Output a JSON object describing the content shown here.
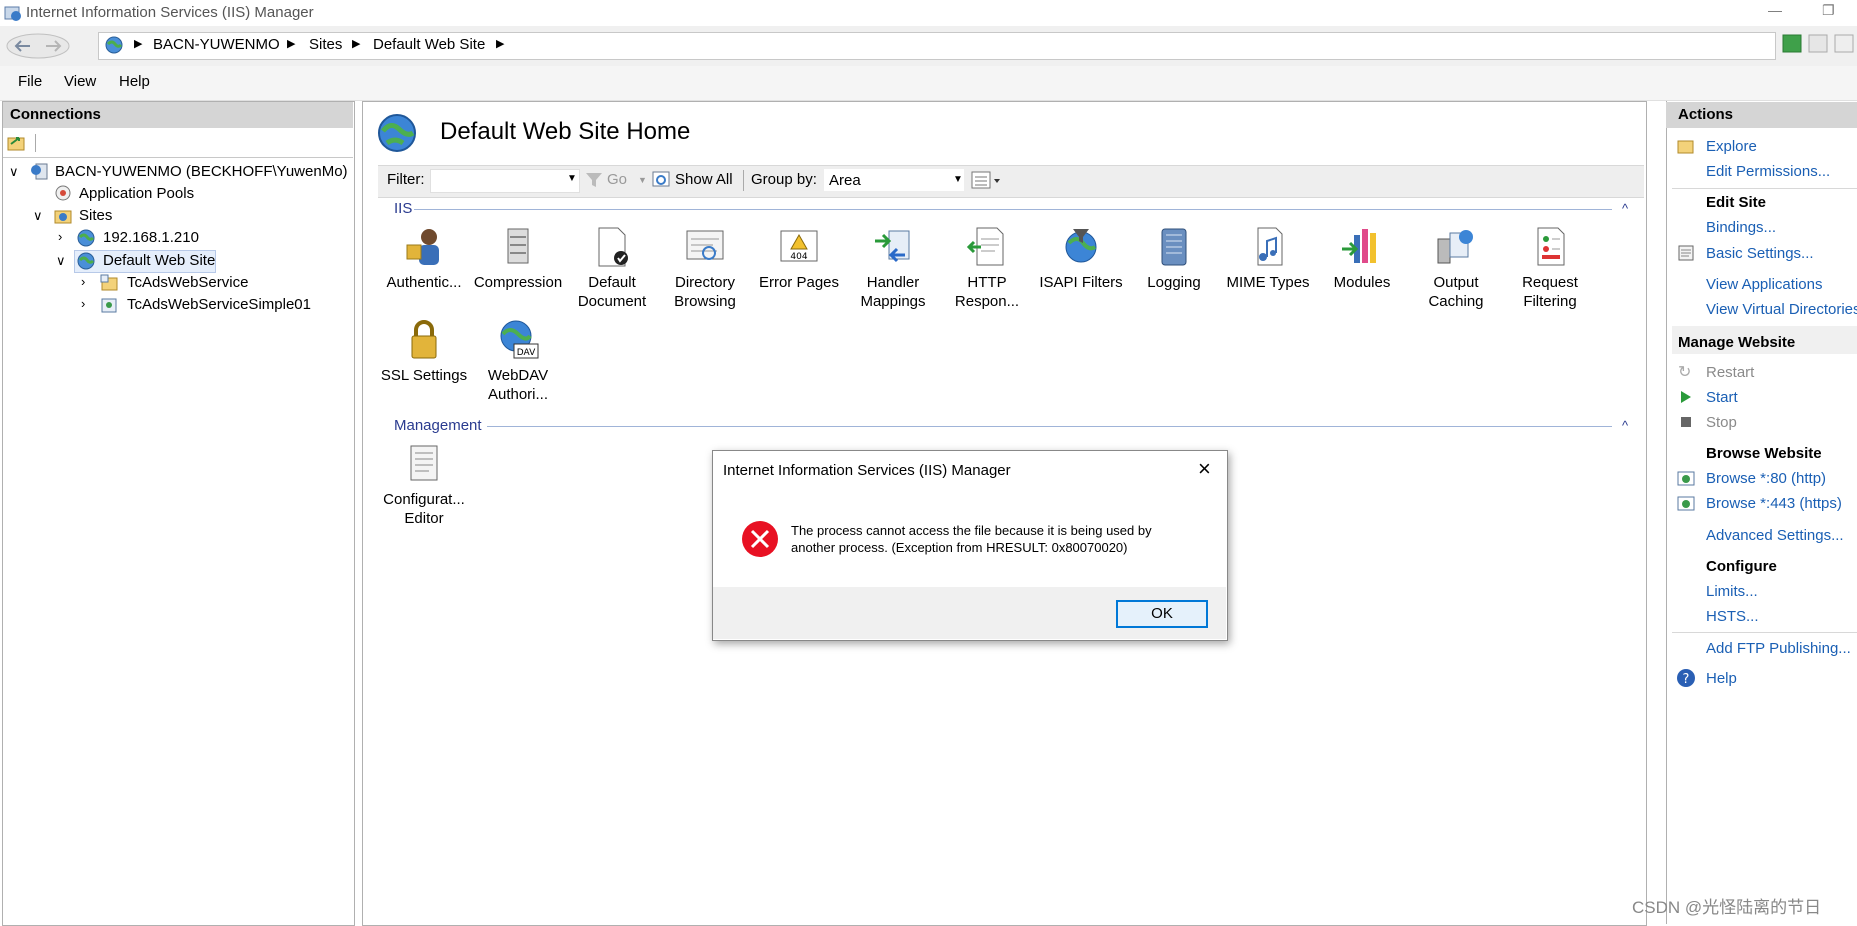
{
  "window": {
    "title": "Internet Information Services (IIS) Manager"
  },
  "address": {
    "crumbs": [
      "BACN-YUWENMO",
      "Sites",
      "Default Web Site"
    ]
  },
  "menu": {
    "file": "File",
    "view": "View",
    "help": "Help"
  },
  "connections": {
    "header": "Connections",
    "tree": {
      "server": "BACN-YUWENMO (BECKHOFF\\YuwenMo)",
      "app_pools": "Application Pools",
      "sites": "Sites",
      "site1": "192.168.1.210",
      "site2": "Default Web Site",
      "app1": "TcAdsWebService",
      "app2": "TcAdsWebServiceSimple01"
    }
  },
  "center": {
    "title": "Default Web Site Home",
    "filter_label": "Filter:",
    "go": "Go",
    "show_all": "Show All",
    "group_by_label": "Group by:",
    "group_by_value": "Area",
    "section_iis": "IIS",
    "section_management": "Management",
    "features": {
      "auth": [
        "Authentic...",
        ""
      ],
      "compression": [
        "Compression",
        ""
      ],
      "default_doc": [
        "Default",
        "Document"
      ],
      "dir_browsing": [
        "Directory",
        "Browsing"
      ],
      "error_pages": [
        "Error Pages",
        ""
      ],
      "handler": [
        "Handler",
        "Mappings"
      ],
      "http_resp": [
        "HTTP",
        "Respon..."
      ],
      "isapi": [
        "ISAPI Filters",
        ""
      ],
      "logging": [
        "Logging",
        ""
      ],
      "mime": [
        "MIME Types",
        ""
      ],
      "modules": [
        "Modules",
        ""
      ],
      "output": [
        "Output",
        "Caching"
      ],
      "request": [
        "Request",
        "Filtering"
      ],
      "ssl": [
        "SSL Settings",
        ""
      ],
      "webdav": [
        "WebDAV",
        "Authori..."
      ],
      "config": [
        "Configurat...",
        "Editor"
      ]
    }
  },
  "actions": {
    "header": "Actions",
    "explore": "Explore",
    "edit_permissions": "Edit Permissions...",
    "edit_site": "Edit Site",
    "bindings": "Bindings...",
    "basic_settings": "Basic Settings...",
    "view_applications": "View Applications",
    "view_virtual_dirs": "View Virtual Directories",
    "manage_website": "Manage Website",
    "restart": "Restart",
    "start": "Start",
    "stop": "Stop",
    "browse_website": "Browse Website",
    "browse_80": "Browse *:80 (http)",
    "browse_443": "Browse *:443 (https)",
    "advanced_settings": "Advanced Settings...",
    "configure": "Configure",
    "limits": "Limits...",
    "hsts": "HSTS...",
    "add_ftp": "Add FTP Publishing...",
    "help": "Help"
  },
  "dialog": {
    "title": "Internet Information Services (IIS) Manager",
    "message_line1": "The process cannot access the file because it is being used by",
    "message_line2": "another process. (Exception from HRESULT: 0x80070020)",
    "ok": "OK"
  },
  "watermark": "CSDN @光怪陆离的节日",
  "colors": {
    "link": "#1a5fb4",
    "error": "#e81123",
    "selection": "#e5eefb",
    "panel_header": "#d5d5d5"
  }
}
